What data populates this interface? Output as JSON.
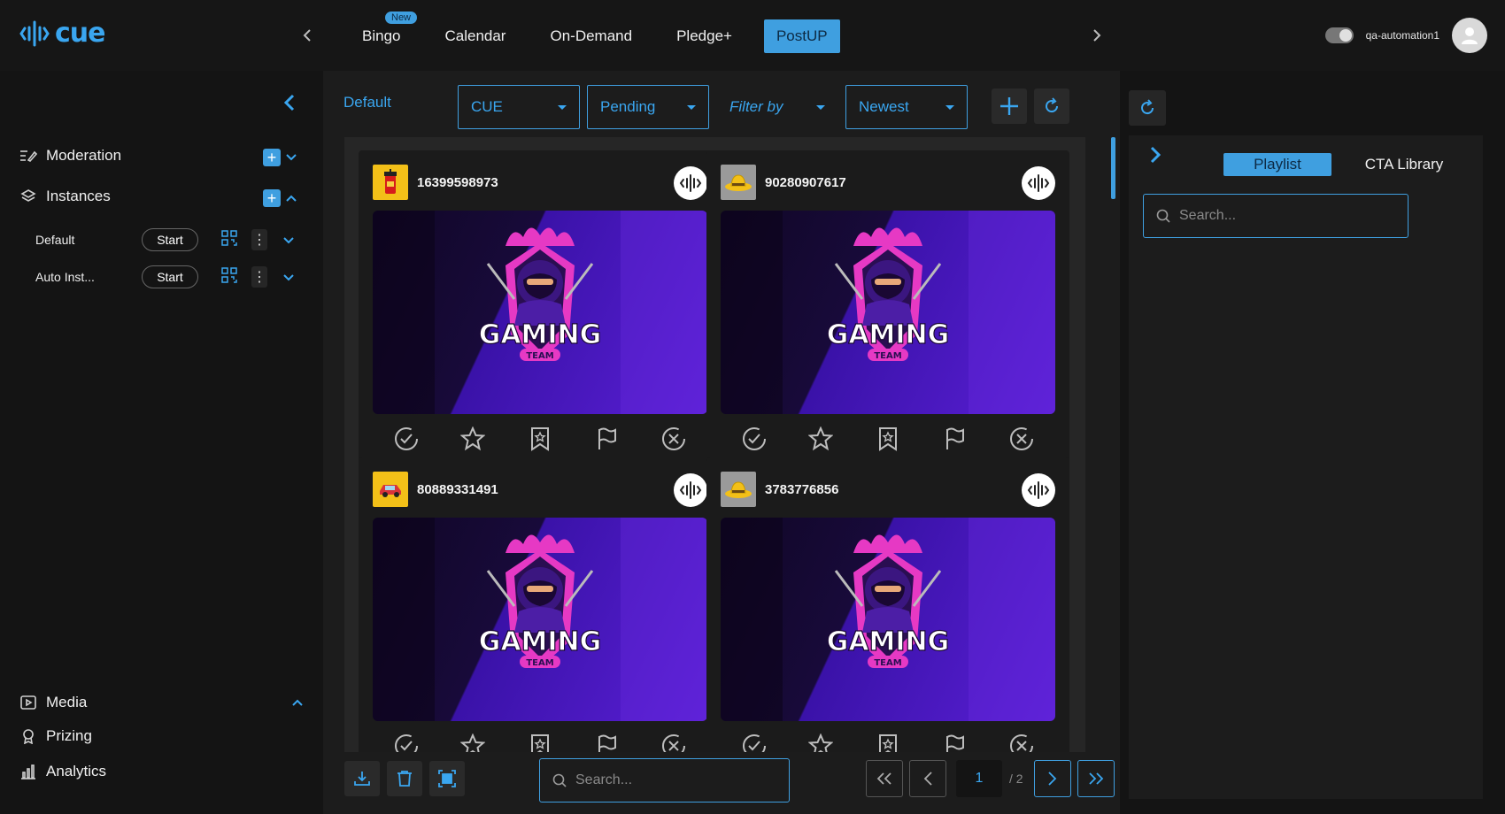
{
  "app": {
    "logo_text": "cue"
  },
  "topnav": {
    "tabs": [
      {
        "label": "Bingo",
        "badge": "New"
      },
      {
        "label": "Calendar"
      },
      {
        "label": "On-Demand"
      },
      {
        "label": "Pledge+"
      },
      {
        "label": "PostUP",
        "active": true
      }
    ]
  },
  "user": {
    "name": "qa-automation1"
  },
  "sidebar": {
    "moderation": "Moderation",
    "instances": "Instances",
    "instance_list": [
      {
        "name": "Default",
        "action": "Start"
      },
      {
        "name": "Auto Inst...",
        "action": "Start"
      }
    ],
    "media": "Media",
    "prizing": "Prizing",
    "analytics": "Analytics"
  },
  "toolbar": {
    "instance_label": "Default",
    "source": "CUE",
    "status": "Pending",
    "filter": "Filter by",
    "sort": "Newest"
  },
  "cards": [
    {
      "id": "16399598973",
      "thumb": "drink"
    },
    {
      "id": "90280907617",
      "thumb": "hat"
    },
    {
      "id": "80889331491",
      "thumb": "car"
    },
    {
      "id": "3783776856",
      "thumb": "hat"
    }
  ],
  "card_media": {
    "title": "GAMING",
    "subtitle": "TEAM"
  },
  "bottom": {
    "search_placeholder": "Search...",
    "current_page": "1",
    "total_pages": "/ 2"
  },
  "panel": {
    "tabs": [
      {
        "label": "Playlist",
        "active": true
      },
      {
        "label": "CTA Library"
      }
    ],
    "search_placeholder": "Search..."
  },
  "colors": {
    "accent": "#3f9fe0",
    "background": "#141414",
    "surface": "#1c1c1c",
    "purple": "#5a1fd6",
    "magenta": "#e639c4"
  }
}
